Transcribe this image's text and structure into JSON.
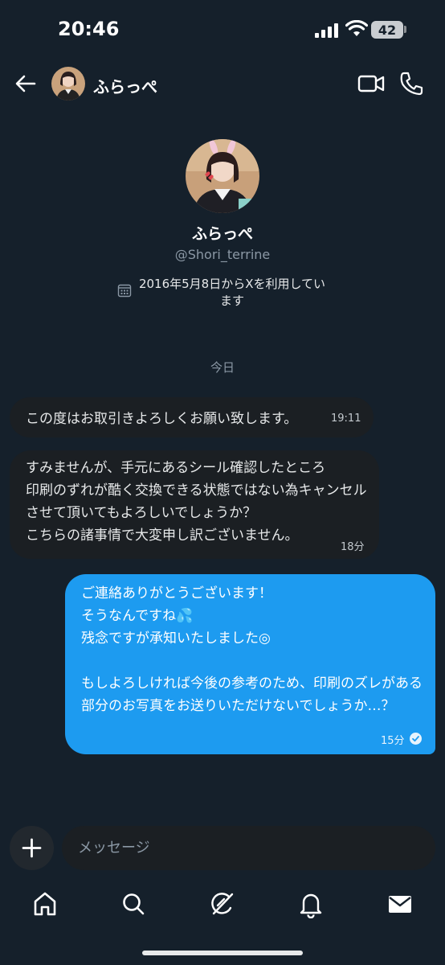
{
  "status_bar": {
    "time": "20:46",
    "battery": "42"
  },
  "header": {
    "name": "ふらっぺ",
    "back_icon": "arrow-left-icon",
    "video_icon": "video-camera-icon",
    "call_icon": "phone-icon"
  },
  "profile": {
    "name": "ふらっぺ",
    "handle": "@Shori_terrine",
    "joined": "2016年5月8日からXを利用しています",
    "joined_icon": "calendar-icon"
  },
  "date_separator": "今日",
  "messages": [
    {
      "direction": "received",
      "text": "この度はお取引きよろしくお願い致します。",
      "time": "19:11"
    },
    {
      "direction": "received",
      "text": "すみませんが、手元にあるシール確認したところ\n印刷のずれが酷く交換できる状態ではない為キャンセルさせて頂いてもよろしいでしょうか？\nこちらの諸事情で大変申し訳ございません。",
      "time": "18分"
    },
    {
      "direction": "sent",
      "text": "ご連絡ありがとうございます！\nそうなんですね💦\n残念ですが承知いたしました◎\n\nもしよろしければ今後の参考のため、印刷のズレがある部分のお写真をお送りいただけないでしょうか…？",
      "time": "15分",
      "status_icon": "read-check-icon"
    }
  ],
  "composer": {
    "placeholder": "メッセージ",
    "add_icon": "plus-icon"
  },
  "bottom_nav": [
    {
      "icon": "home-icon"
    },
    {
      "icon": "search-icon"
    },
    {
      "icon": "grok-icon"
    },
    {
      "icon": "bell-icon"
    },
    {
      "icon": "mail-icon"
    }
  ],
  "colors": {
    "background": "#15202b",
    "accent": "#1d9bf0",
    "received_bubble": "#1b1f23"
  }
}
